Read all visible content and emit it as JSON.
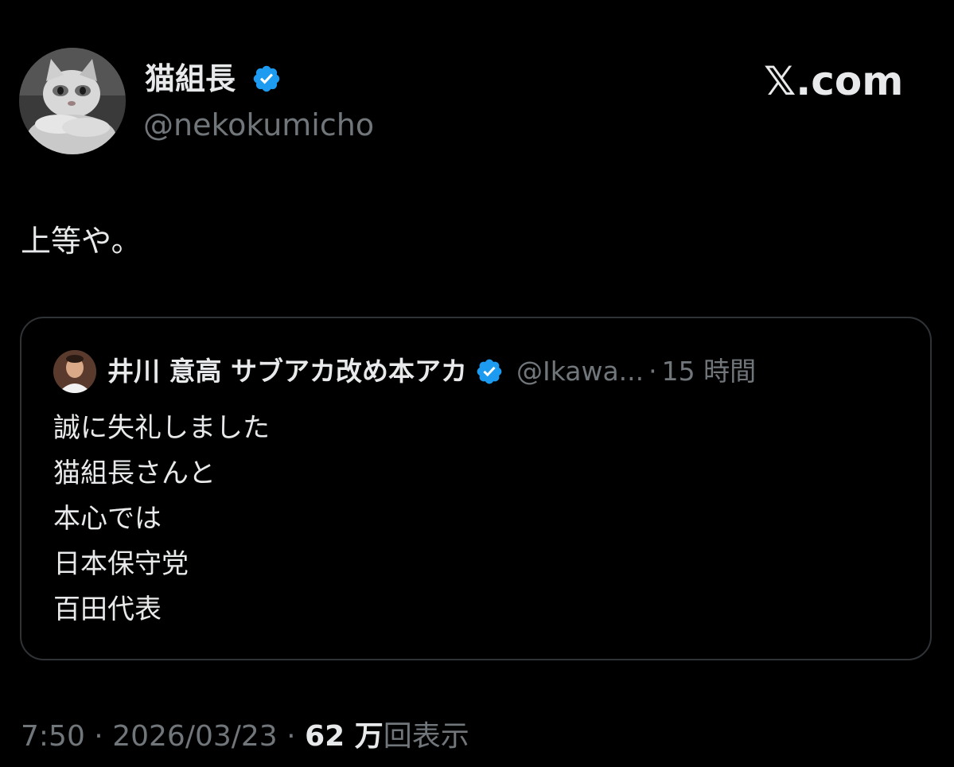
{
  "post": {
    "display_name": "猫組長",
    "handle": "@nekokumicho",
    "verified": true,
    "avatar_icon": "cat-avatar",
    "text": "上等や。"
  },
  "brand": {
    "label": "𝕏.com"
  },
  "quoted_post": {
    "display_name": "井川 意高 サブアカ改め本アカ",
    "handle": "@Ikawa...",
    "separator": "·",
    "time": "15 時間",
    "verified": true,
    "avatar_icon": "person-avatar",
    "lines": [
      "誠に失礼しました",
      "猫組長さんと",
      "本心では",
      "日本保守党",
      "百田代表"
    ]
  },
  "meta": {
    "time": "7:50",
    "separator": "·",
    "date": "2026/03/23",
    "views_count": "62 万",
    "views_label": "回表示"
  },
  "colors": {
    "background": "#000000",
    "text_primary": "#e7e9ea",
    "text_secondary": "#71767b",
    "border": "#2f3336",
    "verified_badge": "#1d9bf0"
  }
}
